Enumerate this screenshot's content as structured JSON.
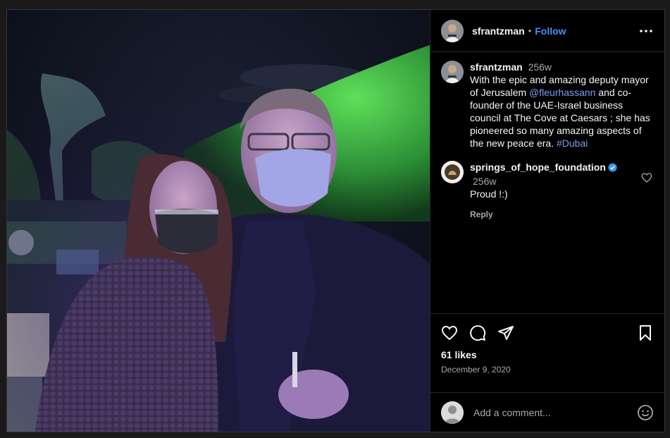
{
  "post": {
    "author": "sfrantzman",
    "follow_label": "Follow",
    "separator": "•",
    "more_icon": "more-horizontal-icon"
  },
  "caption": {
    "author": "sfrantzman",
    "time": "256w",
    "text_1": "With the epic and amazing deputy mayor of Jerusalem ",
    "mention": "@fleurhassann",
    "text_2": " and co-founder of the UAE-Israel business council at The Cove at Caesars ; she has pioneered so many amazing aspects of the new peace era. ",
    "hashtag": "#Dubai"
  },
  "comment": {
    "author": "springs_of_hope_foundation",
    "verified_icon": "verified-badge-icon",
    "time": "256w",
    "text": "Proud !:)",
    "reply_label": "Reply"
  },
  "actions": {
    "icons": [
      "heart-icon",
      "comment-icon",
      "share-icon",
      "bookmark-icon"
    ],
    "likes": "61 likes",
    "date": "December 9, 2020"
  },
  "add_comment": {
    "placeholder": "Add a comment...",
    "emoji_icon": "emoji-icon"
  },
  "colors": {
    "background": "#000000",
    "link": "#4a8df8",
    "mention": "#7e9af0",
    "muted": "#a8a8a8"
  }
}
